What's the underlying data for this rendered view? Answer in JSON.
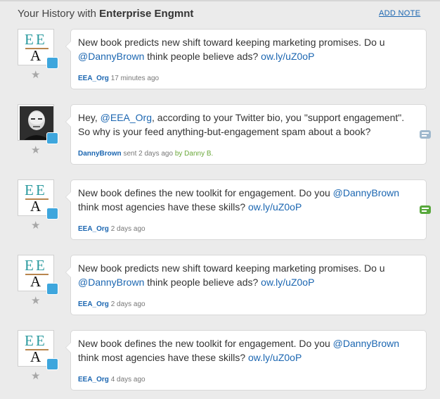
{
  "header": {
    "title_prefix": "Your History with",
    "title_name": "Enterprise Engmnt",
    "add_note": "ADD NOTE"
  },
  "entries": [
    {
      "avatar": "eea-logo",
      "logo": {
        "e1": "E",
        "e2": "E",
        "a": "A"
      },
      "text_parts": [
        "New book predicts new shift toward keeping marketing promises. Do u ",
        "@DannyBrown",
        " think people believe ads? ",
        "ow.ly/uZ0oP"
      ],
      "username": "EEA_Org",
      "meta_text": "17 minutes ago",
      "by_text": ""
    },
    {
      "avatar": "photo",
      "text_parts": [
        "Hey, ",
        "@EEA_Org",
        ", according to your Twitter bio, you \"support engagement\". So why is your feed anything-but-engagement spam about a book?"
      ],
      "username": "DannyBrown",
      "meta_text": "sent 2 days ago",
      "by_text": "by Danny B.",
      "side_icon_color": "#9fb8cd"
    },
    {
      "avatar": "eea-logo",
      "logo": {
        "e1": "E",
        "e2": "E",
        "a": "A"
      },
      "text_parts": [
        "New book defines the new toolkit for engagement. Do you ",
        "@DannyBrown",
        " think most agencies have these skills? ",
        "ow.ly/uZ0oP"
      ],
      "username": "EEA_Org",
      "meta_text": "2 days ago",
      "by_text": "",
      "side_icon_color": "#58a83c"
    },
    {
      "avatar": "eea-logo",
      "logo": {
        "e1": "E",
        "e2": "E",
        "a": "A"
      },
      "text_parts": [
        "New book predicts new shift toward keeping marketing promises. Do u ",
        "@DannyBrown",
        " think people believe ads? ",
        "ow.ly/uZ0oP"
      ],
      "username": "EEA_Org",
      "meta_text": "2 days ago",
      "by_text": ""
    },
    {
      "avatar": "eea-logo",
      "logo": {
        "e1": "E",
        "e2": "E",
        "a": "A"
      },
      "text_parts": [
        "New book defines the new toolkit for engagement. Do you ",
        "@DannyBrown",
        " think most agencies have these skills? ",
        "ow.ly/uZ0oP"
      ],
      "username": "EEA_Org",
      "meta_text": "4 days ago",
      "by_text": ""
    }
  ],
  "star_glyph": "★",
  "colors": {
    "accent": "#1b66b1",
    "twitter": "#3ea6dd",
    "background": "#ebebeb"
  }
}
